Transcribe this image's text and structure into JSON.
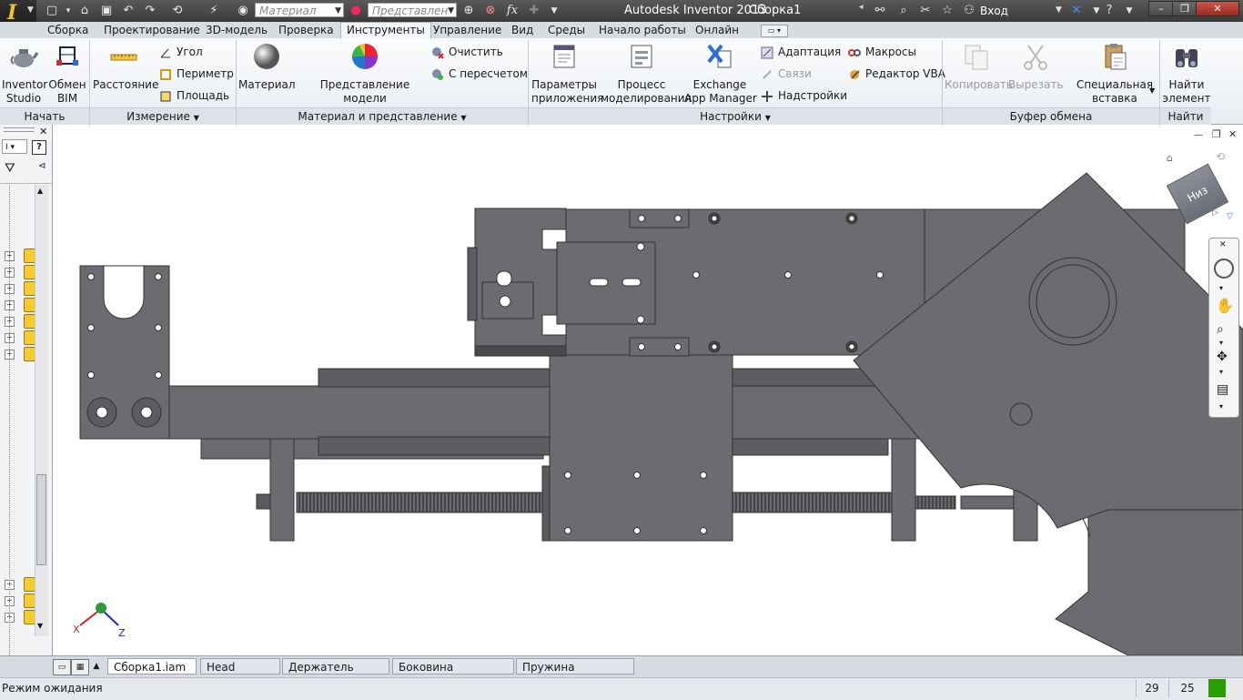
{
  "app": {
    "title": "Autodesk Inventor 2013",
    "document": "Сборка1"
  },
  "qat": {
    "material_placeholder": "Материал",
    "appearance_placeholder": "Представлен",
    "fx": "fx"
  },
  "signin": {
    "label": "Вход"
  },
  "tabs": [
    "Сборка",
    "Проектирование",
    "3D-модель",
    "Проверка",
    "Инструменты",
    "Управление",
    "Вид",
    "Среды",
    "Начало работы",
    "Онлайн"
  ],
  "active_tab": "Инструменты",
  "ribbon": {
    "start": {
      "title": "Начать",
      "inventor_studio": "Inventor\nStudio",
      "bim": "Обмен\nBIM"
    },
    "measure": {
      "title": "Измерение",
      "distance": "Расстояние",
      "angle": "Угол",
      "perimeter": "Периметр",
      "area": "Площадь"
    },
    "material": {
      "title": "Материал и представление",
      "material": "Материал",
      "appearance": "Представление модели",
      "clear": "Очистить",
      "intersect": "С пересчетом"
    },
    "options": {
      "title": "Настройки",
      "app_options": "Параметры\nприложения",
      "workflow": "Процесс\nмоделирования",
      "exchange": "Exchange\nApp Manager",
      "adapt": "Адаптация",
      "links": "Связи",
      "addins": "Надстройки",
      "macros": "Макросы",
      "vba": "Редактор VBA"
    },
    "clipboard": {
      "title": "Буфер обмена",
      "copy": "Копировать",
      "cut": "Вырезать",
      "paste_special": "Специальная\nвставка"
    },
    "find": {
      "title": "Найти",
      "find_item": "Найти\nэлемент"
    }
  },
  "viewcube": {
    "face": "Низ"
  },
  "triad": {
    "x": "X",
    "z": "Z"
  },
  "doc_tabs": [
    {
      "label": "Сборка1.iam",
      "active": true
    },
    {
      "label": "Head mov.ipt",
      "active": false
    },
    {
      "label": "Держатель PSD.ipt",
      "active": false
    },
    {
      "label": "Боковина каретк...ipt",
      "active": false
    },
    {
      "label": "Пружина пласти...ipt",
      "active": false
    }
  ],
  "status": {
    "text": "Режим ожидания",
    "count1": "29",
    "count2": "25"
  },
  "colors": {
    "part": "#6c6c70",
    "part_dark": "#4a4a4e",
    "ribbon_bg": "#eef1f5",
    "title_bg": "#404040"
  }
}
